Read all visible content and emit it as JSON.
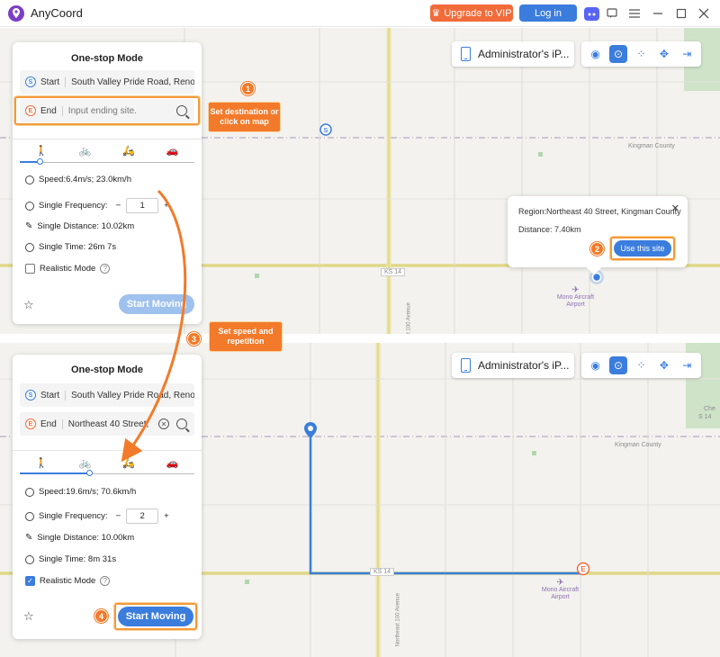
{
  "app": {
    "title": "AnyCoord"
  },
  "titlebar": {
    "vip_label": "Upgrade to VIP",
    "login_label": "Log in"
  },
  "device": {
    "name": "Administrator's iP..."
  },
  "top_panel": {
    "title": "One-stop Mode",
    "start_label": "Start",
    "start_value": "South Valley Pride Road,  Reno",
    "end_label": "End",
    "end_placeholder": "Input ending site.",
    "speed": "Speed:6.4m/s; 23.0km/h",
    "frequency_label": "Single Frequency:",
    "frequency_value": "1",
    "distance": "Single Distance: 10.02km",
    "time": "Single Time: 26m 7s",
    "realistic_label": "Realistic Mode",
    "start_moving_label": "Start Moving",
    "speed_level": 0.12
  },
  "bottom_panel": {
    "title": "One-stop Mode",
    "start_label": "Start",
    "start_value": "South Valley Pride Road,  Reno",
    "end_label": "End",
    "end_value": "Northeast 40 Street,",
    "speed": "Speed:19.6m/s; 70.6km/h",
    "frequency_label": "Single Frequency:",
    "frequency_value": "2",
    "distance": "Single Distance: 10.00km",
    "time": "Single Time: 8m 31s",
    "realistic_label": "Realistic Mode",
    "start_moving_label": "Start Moving",
    "speed_level": 0.4
  },
  "popup": {
    "region": "Region:Northeast 40 Street, Kingman County",
    "distance": "Distance: 7.40km",
    "use_site_label": "Use this site"
  },
  "callouts": {
    "c1_num": "1",
    "c1_text": "Set destination or click on map",
    "c2_num": "2",
    "c3_num": "3",
    "c3_text": "Set speed and repetition",
    "c4_num": "4"
  },
  "map": {
    "county": "Kingman County",
    "highway": "KS 14",
    "avenue": "Northeast 100 Avenue",
    "airport": "Mono Aircraft Airport",
    "che": "Che",
    "s14": "S 14"
  },
  "colors": {
    "accent": "#3b7ddd",
    "orange": "#f27a2a",
    "vip": "#f26b3a"
  }
}
